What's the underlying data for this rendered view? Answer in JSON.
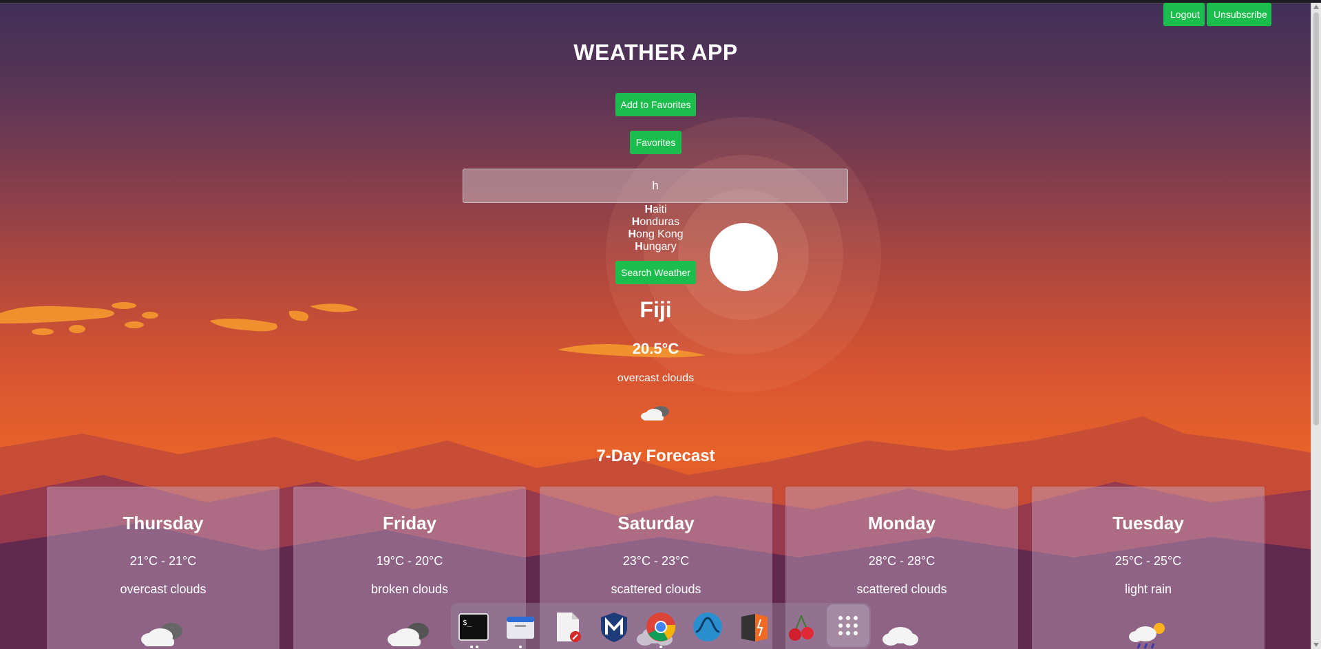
{
  "header": {
    "logout_label": "Logout",
    "unsubscribe_label": "Unsubscribe",
    "title": "WEATHER APP"
  },
  "actions": {
    "add_favorites_label": "Add to Favorites",
    "favorites_label": "Favorites",
    "search_weather_label": "Search Weather"
  },
  "search": {
    "value": "h",
    "suggestions": [
      {
        "highlight": "H",
        "rest": "aiti"
      },
      {
        "highlight": "H",
        "rest": "onduras"
      },
      {
        "highlight": "H",
        "rest": "ong Kong"
      },
      {
        "highlight": "H",
        "rest": "ungary"
      }
    ]
  },
  "current": {
    "city": "Fiji",
    "temperature": "20.5°C",
    "description": "overcast clouds",
    "icon": "overcast-clouds-icon"
  },
  "forecast": {
    "title": "7-Day Forecast",
    "days": [
      {
        "day": "Thursday",
        "range": "21°C - 21°C",
        "description": "overcast clouds",
        "icon": "overcast-clouds-icon"
      },
      {
        "day": "Friday",
        "range": "19°C - 20°C",
        "description": "broken clouds",
        "icon": "broken-clouds-icon"
      },
      {
        "day": "Saturday",
        "range": "23°C - 23°C",
        "description": "scattered clouds",
        "icon": "scattered-clouds-icon"
      },
      {
        "day": "Monday",
        "range": "28°C - 28°C",
        "description": "scattered clouds",
        "icon": "scattered-clouds-icon"
      },
      {
        "day": "Tuesday",
        "range": "25°C - 25°C",
        "description": "light rain",
        "icon": "light-rain-icon"
      }
    ]
  },
  "dock": {
    "apps": [
      "terminal-icon",
      "file-manager-icon",
      "text-editor-icon",
      "metasploit-icon",
      "chrome-icon",
      "wireshark-icon",
      "burpsuite-icon",
      "cherrytree-icon",
      "app-grid-icon"
    ]
  },
  "colors": {
    "button_green": "#1bbd4c",
    "sky_top": "#402f58",
    "sky_bottom": "#e8622a"
  }
}
